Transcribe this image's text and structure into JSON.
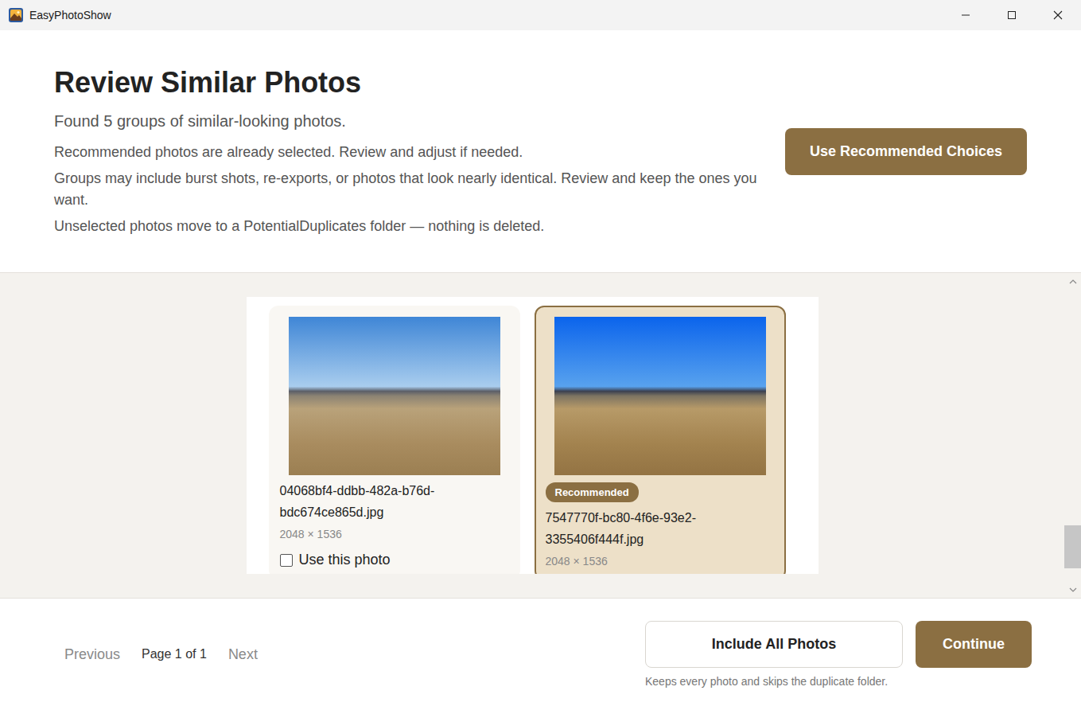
{
  "window": {
    "title": "EasyPhotoShow"
  },
  "header": {
    "title": "Review Similar Photos",
    "summary": "Found 5 groups of similar-looking photos.",
    "notes": [
      "Recommended photos are already selected. Review and adjust if needed.",
      "Groups may include burst shots, re-exports, or photos that look nearly identical. Review and keep the ones you want.",
      "Unselected photos move to a PotentialDuplicates folder — nothing is deleted."
    ],
    "action": "Use Recommended Choices"
  },
  "photos": [
    {
      "filename": "04068bf4-ddbb-482a-b76d-bdc674ce865d.jpg",
      "dimensions": "2048 × 1536",
      "selected": false,
      "checkbox": {
        "label": "Use this photo",
        "checked": false
      }
    },
    {
      "filename": "7547770f-bc80-4f6e-93e2-3355406f444f.jpg",
      "dimensions": "2048 × 1536",
      "selected": true,
      "badge": "Recommended"
    }
  ],
  "scroll": {
    "level": 0.95
  },
  "pagination": {
    "previous": {
      "label": "Previous",
      "disabled": true
    },
    "page": "Page 1 of 1",
    "next": {
      "label": "Next",
      "disabled": true
    }
  },
  "footer": {
    "buttons": [
      {
        "label": "Include All Photos",
        "kind": "secondary"
      },
      {
        "label": "Continue",
        "kind": "primary"
      }
    ],
    "caption": "Keeps every photo and skips the duplicate folder."
  }
}
